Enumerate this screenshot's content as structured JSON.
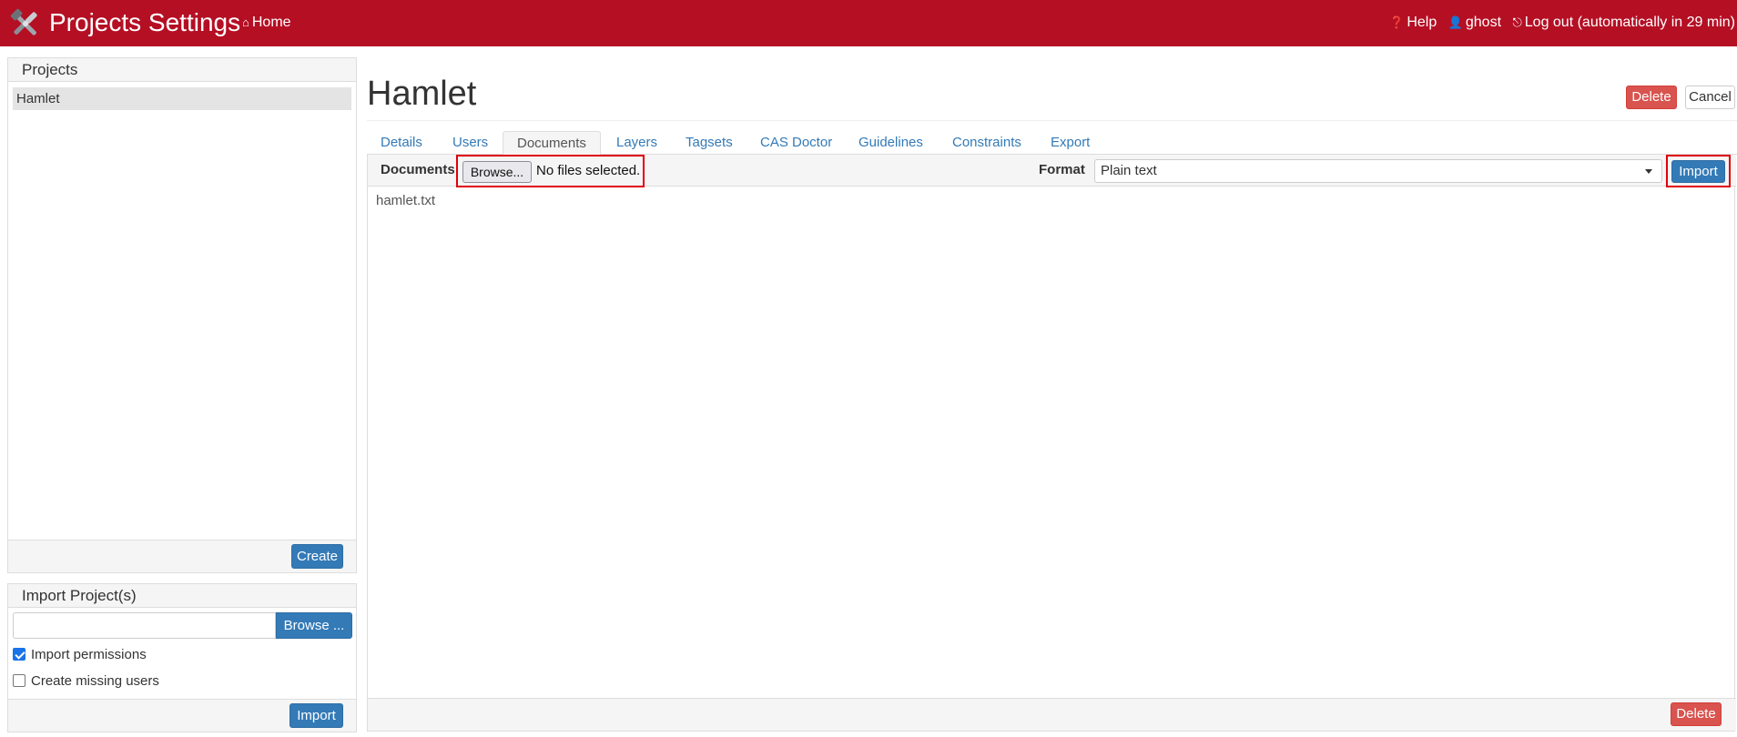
{
  "topbar": {
    "app_title": "Projects Settings",
    "home_label": "Home",
    "help_label": "Help",
    "user_label": "ghost",
    "logout_label": "Log out (automatically in 29 min)"
  },
  "projects_panel": {
    "title": "Projects",
    "items": [
      "Hamlet"
    ],
    "create_label": "Create"
  },
  "import_panel": {
    "title": "Import Project(s)",
    "file_value": "",
    "browse_label": "Browse ...",
    "options": [
      {
        "label": "Import permissions",
        "checked": true
      },
      {
        "label": "Create missing users",
        "checked": false
      }
    ],
    "import_label": "Import"
  },
  "main": {
    "title": "Hamlet",
    "delete_label": "Delete",
    "cancel_label": "Cancel",
    "tabs": [
      {
        "label": "Details"
      },
      {
        "label": "Users"
      },
      {
        "label": "Documents",
        "active": true
      },
      {
        "label": "Layers"
      },
      {
        "label": "Tagsets"
      },
      {
        "label": "CAS Doctor"
      },
      {
        "label": "Guidelines"
      },
      {
        "label": "Constraints"
      },
      {
        "label": "Export"
      }
    ],
    "documents": {
      "label": "Documents",
      "browse_label": "Browse...",
      "file_status": "No files selected.",
      "format_label": "Format",
      "format_value": "Plain text",
      "import_label": "Import",
      "files": [
        "hamlet.txt"
      ],
      "delete_label": "Delete"
    }
  },
  "colors": {
    "topbar": "#b50f24",
    "primary": "#337ab7",
    "danger": "#d9534f",
    "highlight_box": "#e0000a"
  }
}
